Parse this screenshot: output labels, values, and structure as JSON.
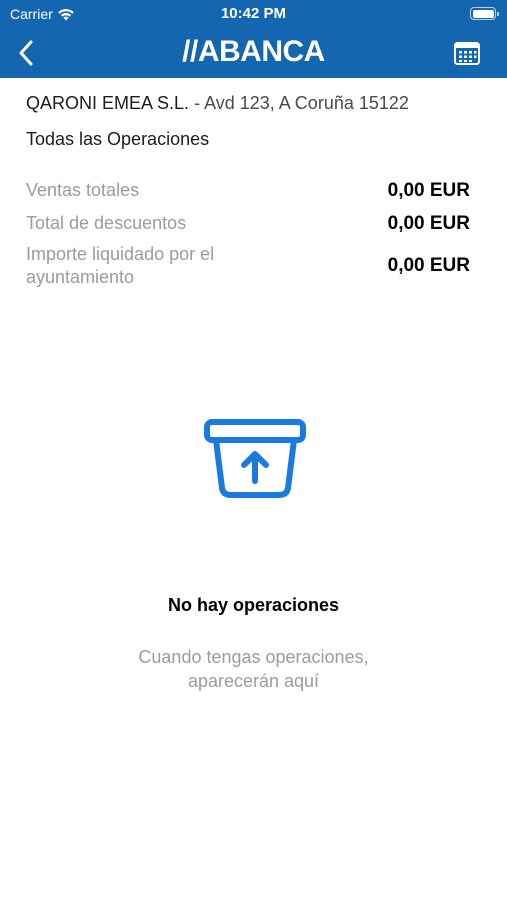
{
  "status_bar": {
    "carrier": "Carrier",
    "time": "10:42 PM"
  },
  "header": {
    "logo_text": "//ABANCA",
    "back_icon": "chevron-left-icon",
    "calendar_icon": "calendar-icon"
  },
  "merchant": {
    "name": "QARONI EMEA S.L.",
    "address": "- Avd 123, A Coruña 15122"
  },
  "filter_label": "Todas las Operaciones",
  "summary": [
    {
      "label": "Ventas totales",
      "value": "0,00 EUR"
    },
    {
      "label": "Total de descuentos",
      "value": "0,00 EUR"
    },
    {
      "label": "Importe liquidado por el ayuntamiento",
      "value": "0,00 EUR"
    }
  ],
  "empty_state": {
    "icon": "box-upload-icon",
    "title": "No hay operaciones",
    "message_line1": "Cuando tengas operaciones,",
    "message_line2": "aparecerán aquí"
  },
  "colors": {
    "brand": "#1466b0",
    "accent_icon": "#1a7ae0",
    "muted_text": "#9b9ba0"
  }
}
